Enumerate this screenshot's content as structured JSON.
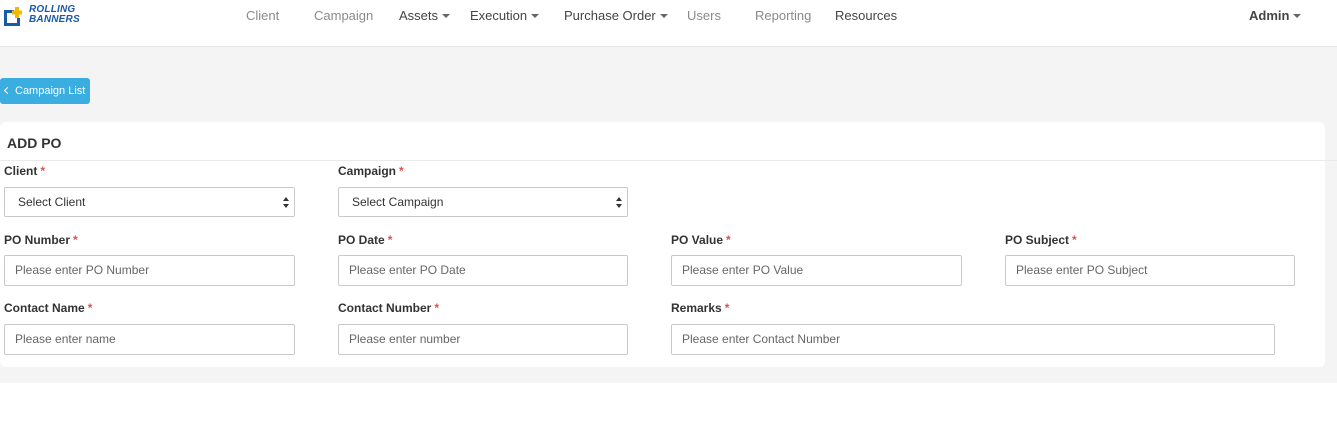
{
  "brand": {
    "line1": "ROLLING",
    "line2": "BANNERS",
    "colors": {
      "blue": "#1b5aa6",
      "yellow": "#f5b800"
    }
  },
  "nav": {
    "client": "Client",
    "campaign": "Campaign",
    "assets": "Assets",
    "execution": "Execution",
    "purchase_order": "Purchase Order",
    "users": "Users",
    "reporting": "Reporting",
    "resources": "Resources",
    "admin": "Admin"
  },
  "back_button": {
    "label": "Campaign List",
    "color": "#3aaee0"
  },
  "form": {
    "title": "ADD PO",
    "required_mark": "*",
    "client": {
      "label": "Client",
      "value": "Select Client"
    },
    "campaign": {
      "label": "Campaign",
      "value": "Select Campaign"
    },
    "po_number": {
      "label": "PO Number",
      "placeholder": "Please enter PO Number"
    },
    "po_date": {
      "label": "PO Date",
      "placeholder": "Please enter PO Date"
    },
    "po_value": {
      "label": "PO Value",
      "placeholder": "Please enter PO Value"
    },
    "po_subject": {
      "label": "PO Subject",
      "placeholder": "Please enter PO Subject"
    },
    "contact_name": {
      "label": "Contact Name",
      "placeholder": "Please enter name"
    },
    "contact_number": {
      "label": "Contact Number",
      "placeholder": "Please enter number"
    },
    "remarks": {
      "label": "Remarks",
      "placeholder": "Please enter Contact Number"
    }
  }
}
